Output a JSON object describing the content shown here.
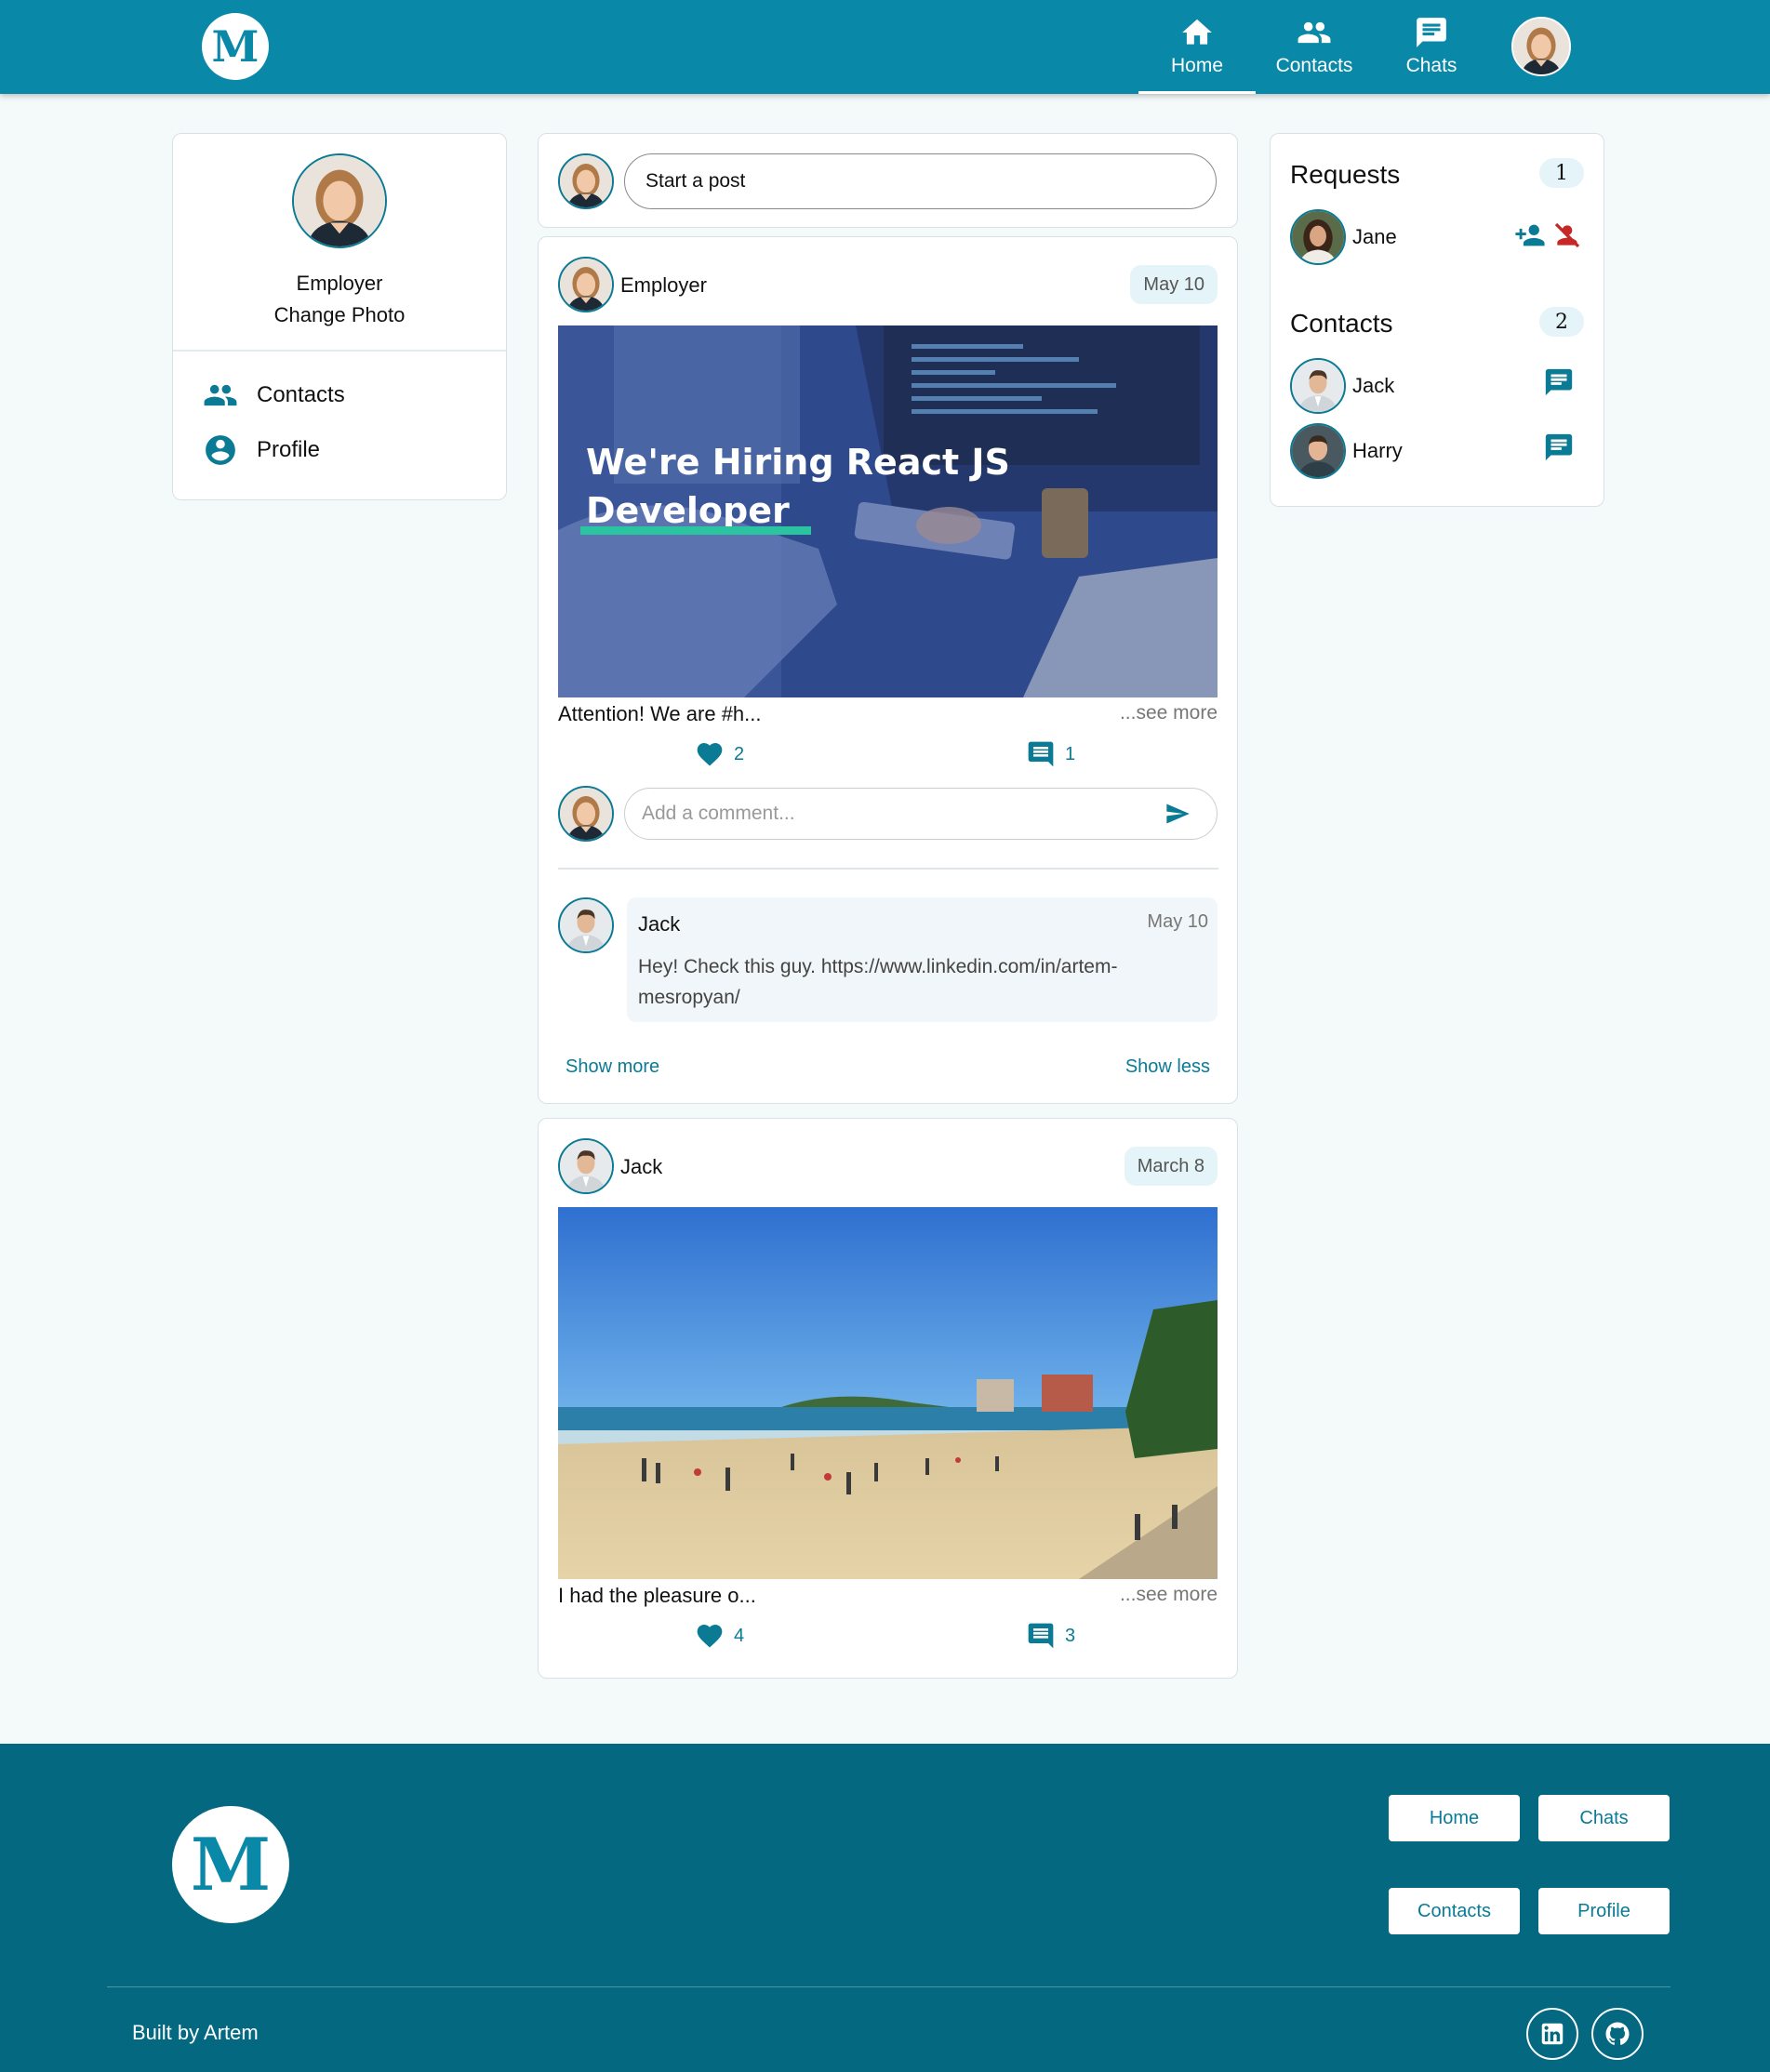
{
  "header": {
    "logo_letter": "M",
    "nav": [
      {
        "label": "Home",
        "icon": "home-icon",
        "active": true
      },
      {
        "label": "Contacts",
        "icon": "people-icon"
      },
      {
        "label": "Chats",
        "icon": "chat-icon"
      }
    ]
  },
  "sidebar": {
    "profile_name": "Employer",
    "change_photo": "Change Photo",
    "links": [
      {
        "label": "Contacts",
        "icon": "people-icon"
      },
      {
        "label": "Profile",
        "icon": "account-circle-icon"
      }
    ]
  },
  "composer": {
    "placeholder": "Start a post"
  },
  "posts": [
    {
      "author": "Employer",
      "date": "May 10",
      "image_headline_line1": "We're Hiring React JS",
      "image_headline_line2": "Developer",
      "text": "Attention! We are #h...",
      "see_more": "...see more",
      "likes": "2",
      "comments": "1",
      "comment_placeholder": "Add a comment...",
      "comment": {
        "author": "Jack",
        "date": "May 10",
        "text": "Hey! Check this guy. https://www.linkedin.com/in/artem-mesropyan/"
      },
      "show_more": "Show more",
      "show_less": "Show less"
    },
    {
      "author": "Jack",
      "date": "March 8",
      "text": "I had the pleasure o...",
      "see_more": "...see more",
      "likes": "4",
      "comments": "3"
    }
  ],
  "right_panel": {
    "requests_title": "Requests",
    "requests_count": "1",
    "requests": [
      {
        "name": "Jane"
      }
    ],
    "contacts_title": "Contacts",
    "contacts_count": "2",
    "contacts": [
      {
        "name": "Jack"
      },
      {
        "name": "Harry"
      }
    ]
  },
  "footer": {
    "logo_letter": "M",
    "buttons": [
      "Home",
      "Chats",
      "Contacts",
      "Profile"
    ],
    "built_by": "Built by Artem",
    "social": [
      "linkedin-icon",
      "github-icon"
    ]
  },
  "colors": {
    "header": "#0a88a8",
    "footer": "#036880",
    "accent": "#0a7a95",
    "background": "#f4f9fa"
  }
}
